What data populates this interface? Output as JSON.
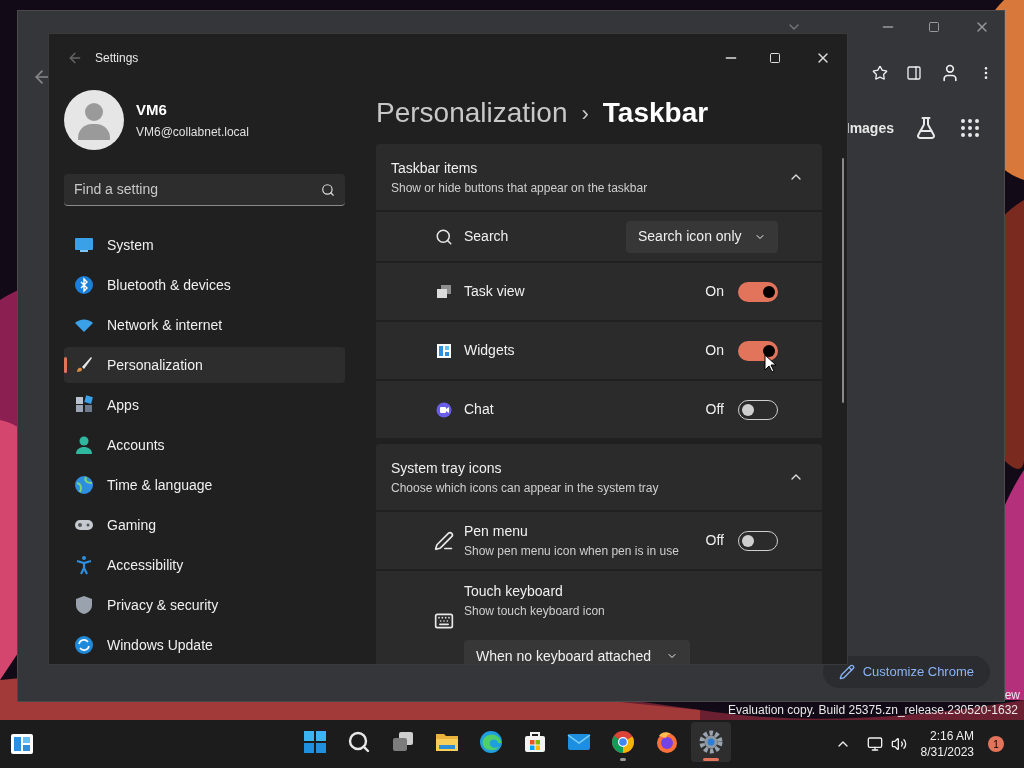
{
  "browser": {
    "toolbar_link": "Images",
    "customize_button": "Customize Chrome"
  },
  "settings": {
    "title": "Settings",
    "user": {
      "name": "VM6",
      "email": "VM6@collabnet.local"
    },
    "search": {
      "placeholder": "Find a setting"
    },
    "nav": [
      {
        "label": "System",
        "selected": false
      },
      {
        "label": "Bluetooth & devices",
        "selected": false
      },
      {
        "label": "Network & internet",
        "selected": false
      },
      {
        "label": "Personalization",
        "selected": true
      },
      {
        "label": "Apps",
        "selected": false
      },
      {
        "label": "Accounts",
        "selected": false
      },
      {
        "label": "Time & language",
        "selected": false
      },
      {
        "label": "Gaming",
        "selected": false
      },
      {
        "label": "Accessibility",
        "selected": false
      },
      {
        "label": "Privacy & security",
        "selected": false
      },
      {
        "label": "Windows Update",
        "selected": false
      }
    ],
    "breadcrumb": {
      "parent": "Personalization",
      "separator": "›",
      "current": "Taskbar"
    },
    "sections": [
      {
        "title": "Taskbar items",
        "subtitle": "Show or hide buttons that appear on the taskbar",
        "expanded": true,
        "rows": [
          {
            "kind": "dropdown",
            "label": "Search",
            "value": "Search icon only"
          },
          {
            "kind": "toggle",
            "label": "Task view",
            "state_label": "On",
            "on": true
          },
          {
            "kind": "toggle",
            "label": "Widgets",
            "state_label": "On",
            "on": true
          },
          {
            "kind": "toggle",
            "label": "Chat",
            "state_label": "Off",
            "on": false
          }
        ]
      },
      {
        "title": "System tray icons",
        "subtitle": "Choose which icons can appear in the system tray",
        "expanded": true,
        "rows": [
          {
            "kind": "toggle",
            "label": "Pen menu",
            "description": "Show pen menu icon when pen is in use",
            "state_label": "Off",
            "on": false
          },
          {
            "kind": "dropdown_below",
            "label": "Touch keyboard",
            "description": "Show touch keyboard icon",
            "value": "When no keyboard attached"
          }
        ]
      }
    ]
  },
  "desktop": {
    "watermark_top": "ew",
    "watermark": "Evaluation copy. Build 25375.zn_release.230520-1632"
  },
  "taskbar": {
    "apps": [
      {
        "selected": false,
        "running": false
      },
      {
        "selected": false,
        "running": false
      },
      {
        "selected": false,
        "running": false
      },
      {
        "selected": false,
        "running": false
      },
      {
        "selected": false,
        "running": false
      },
      {
        "selected": false,
        "running": false
      },
      {
        "selected": false,
        "running": false
      },
      {
        "selected": false,
        "running": true
      },
      {
        "selected": false,
        "running": false
      },
      {
        "selected": true,
        "running": true
      }
    ],
    "time": "2:16 AM",
    "date": "8/31/2023",
    "notifications": "1"
  }
}
